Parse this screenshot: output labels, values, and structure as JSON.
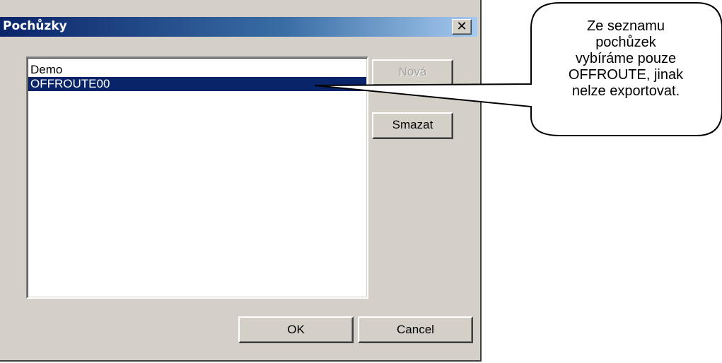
{
  "dialog": {
    "title": "Pochůzky",
    "close_label": "✕",
    "list_items": [
      "Demo",
      "OFFROUTE00"
    ],
    "selected_index": 1,
    "buttons": {
      "new_label": "Nová",
      "delete_label": "Smazat",
      "ok_label": "OK",
      "cancel_label": "Cancel"
    }
  },
  "callout": {
    "lines": [
      "Ze seznamu",
      "pochůzek",
      "vybíráme pouze",
      "OFFROUTE, jinak",
      "nelze exportovat."
    ]
  },
  "colors": {
    "dialog_bg": "#d4d0c8",
    "title_gradient_start": "#0a246a",
    "title_gradient_end": "#a6caf0",
    "selection": "#0a246a"
  }
}
